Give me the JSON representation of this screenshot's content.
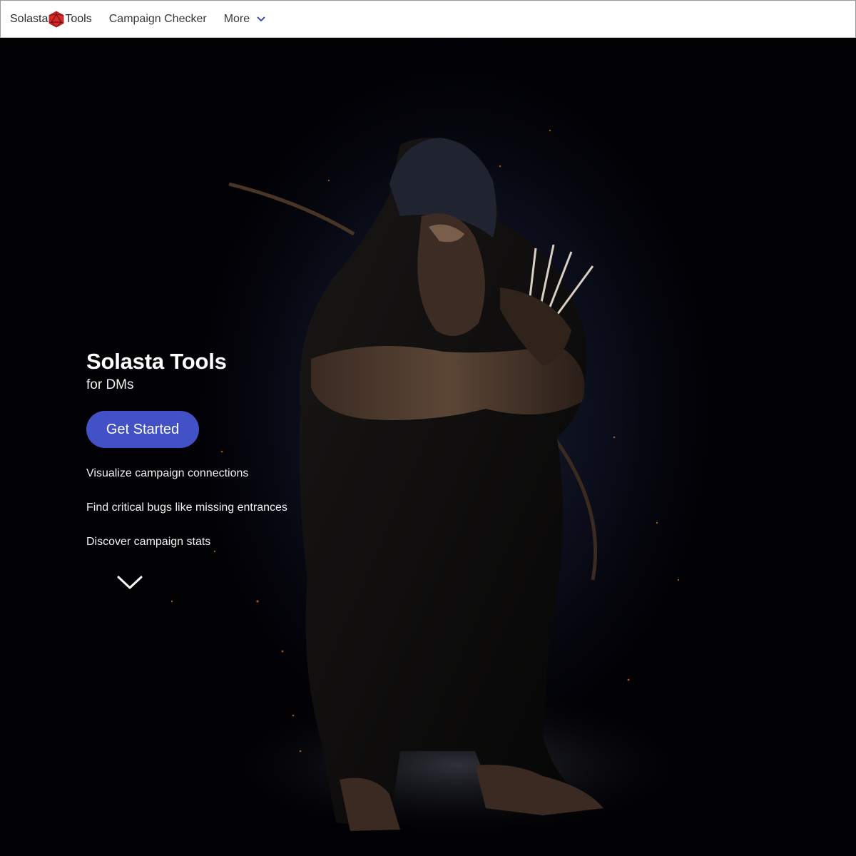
{
  "nav": {
    "brand_left": "Solasta",
    "brand_right": "Tools",
    "links": [
      {
        "label": "Campaign Checker"
      },
      {
        "label": "More"
      }
    ]
  },
  "hero": {
    "title": "Solasta Tools",
    "subtitle": "for DMs",
    "cta_label": "Get Started",
    "features": [
      "Visualize campaign connections",
      "Find critical bugs like missing entrances",
      "Discover campaign stats"
    ]
  },
  "icons": {
    "logo": "d20-dice-icon",
    "more": "chevron-down-icon",
    "scroll": "chevron-down-icon"
  },
  "colors": {
    "accent": "#4351c7",
    "logo_red": "#d42a2a",
    "hero_bg": "#010104",
    "nav_bg": "#ffffff"
  }
}
